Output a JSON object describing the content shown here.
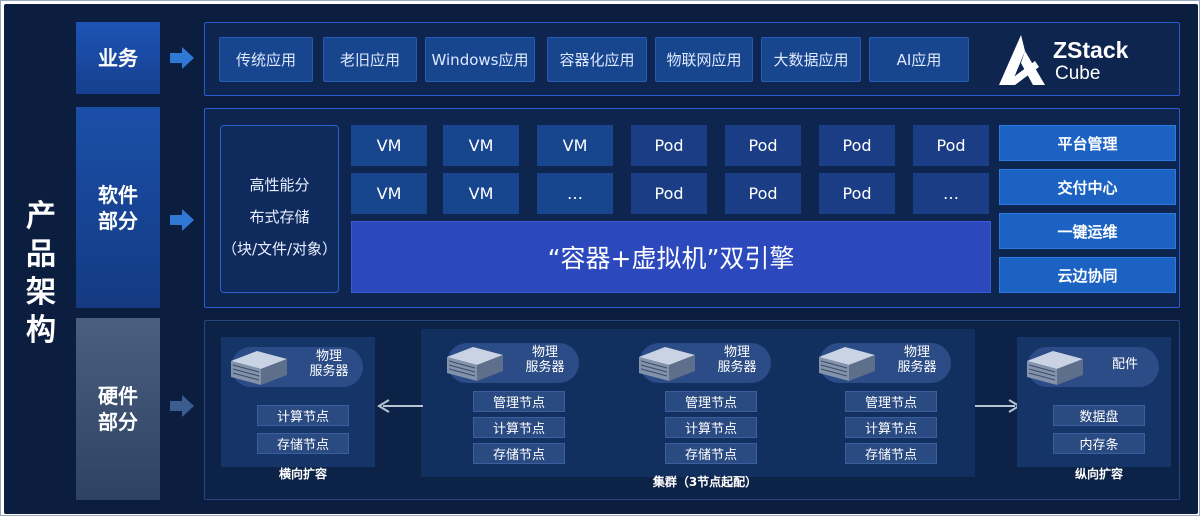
{
  "title_chars": [
    "产",
    "品",
    "架",
    "构"
  ],
  "rows": {
    "business": "业务",
    "software": [
      "软件",
      "部分"
    ],
    "hardware": [
      "硬件",
      "部分"
    ]
  },
  "business_apps": [
    "传统应用",
    "老旧应用",
    "Windows应用",
    "容器化应用",
    "物联网应用",
    "大数据应用",
    "AI应用"
  ],
  "logo": {
    "line1": "ZStack",
    "line2": "Cube"
  },
  "storage": {
    "line1": "高性能分",
    "line2": "布式存储",
    "line3": "（块/文件/对象）"
  },
  "workloads": {
    "row1": [
      "VM",
      "VM",
      "VM",
      "Pod",
      "Pod",
      "Pod",
      "Pod"
    ],
    "row2": [
      "VM",
      "VM",
      "…",
      "Pod",
      "Pod",
      "Pod",
      "…"
    ]
  },
  "engine": "“容器+虚拟机”双引擎",
  "management": [
    "平台管理",
    "交付中心",
    "一键运维",
    "云边协同"
  ],
  "hardware": {
    "server_label": [
      "物理",
      "服务器"
    ],
    "left_nodes": [
      "计算节点",
      "存储节点"
    ],
    "cluster_nodes": [
      "管理节点",
      "计算节点",
      "存储节点"
    ],
    "parts_label": "配件",
    "right_nodes": [
      "数据盘",
      "内存条"
    ],
    "caption_left": "横向扩容",
    "caption_center": "集群（3节点起配）",
    "caption_right": "纵向扩容"
  },
  "colors": {
    "background": "#0b1e3f",
    "accent": "#2b49bd",
    "mgmt": "#1b62c2"
  }
}
